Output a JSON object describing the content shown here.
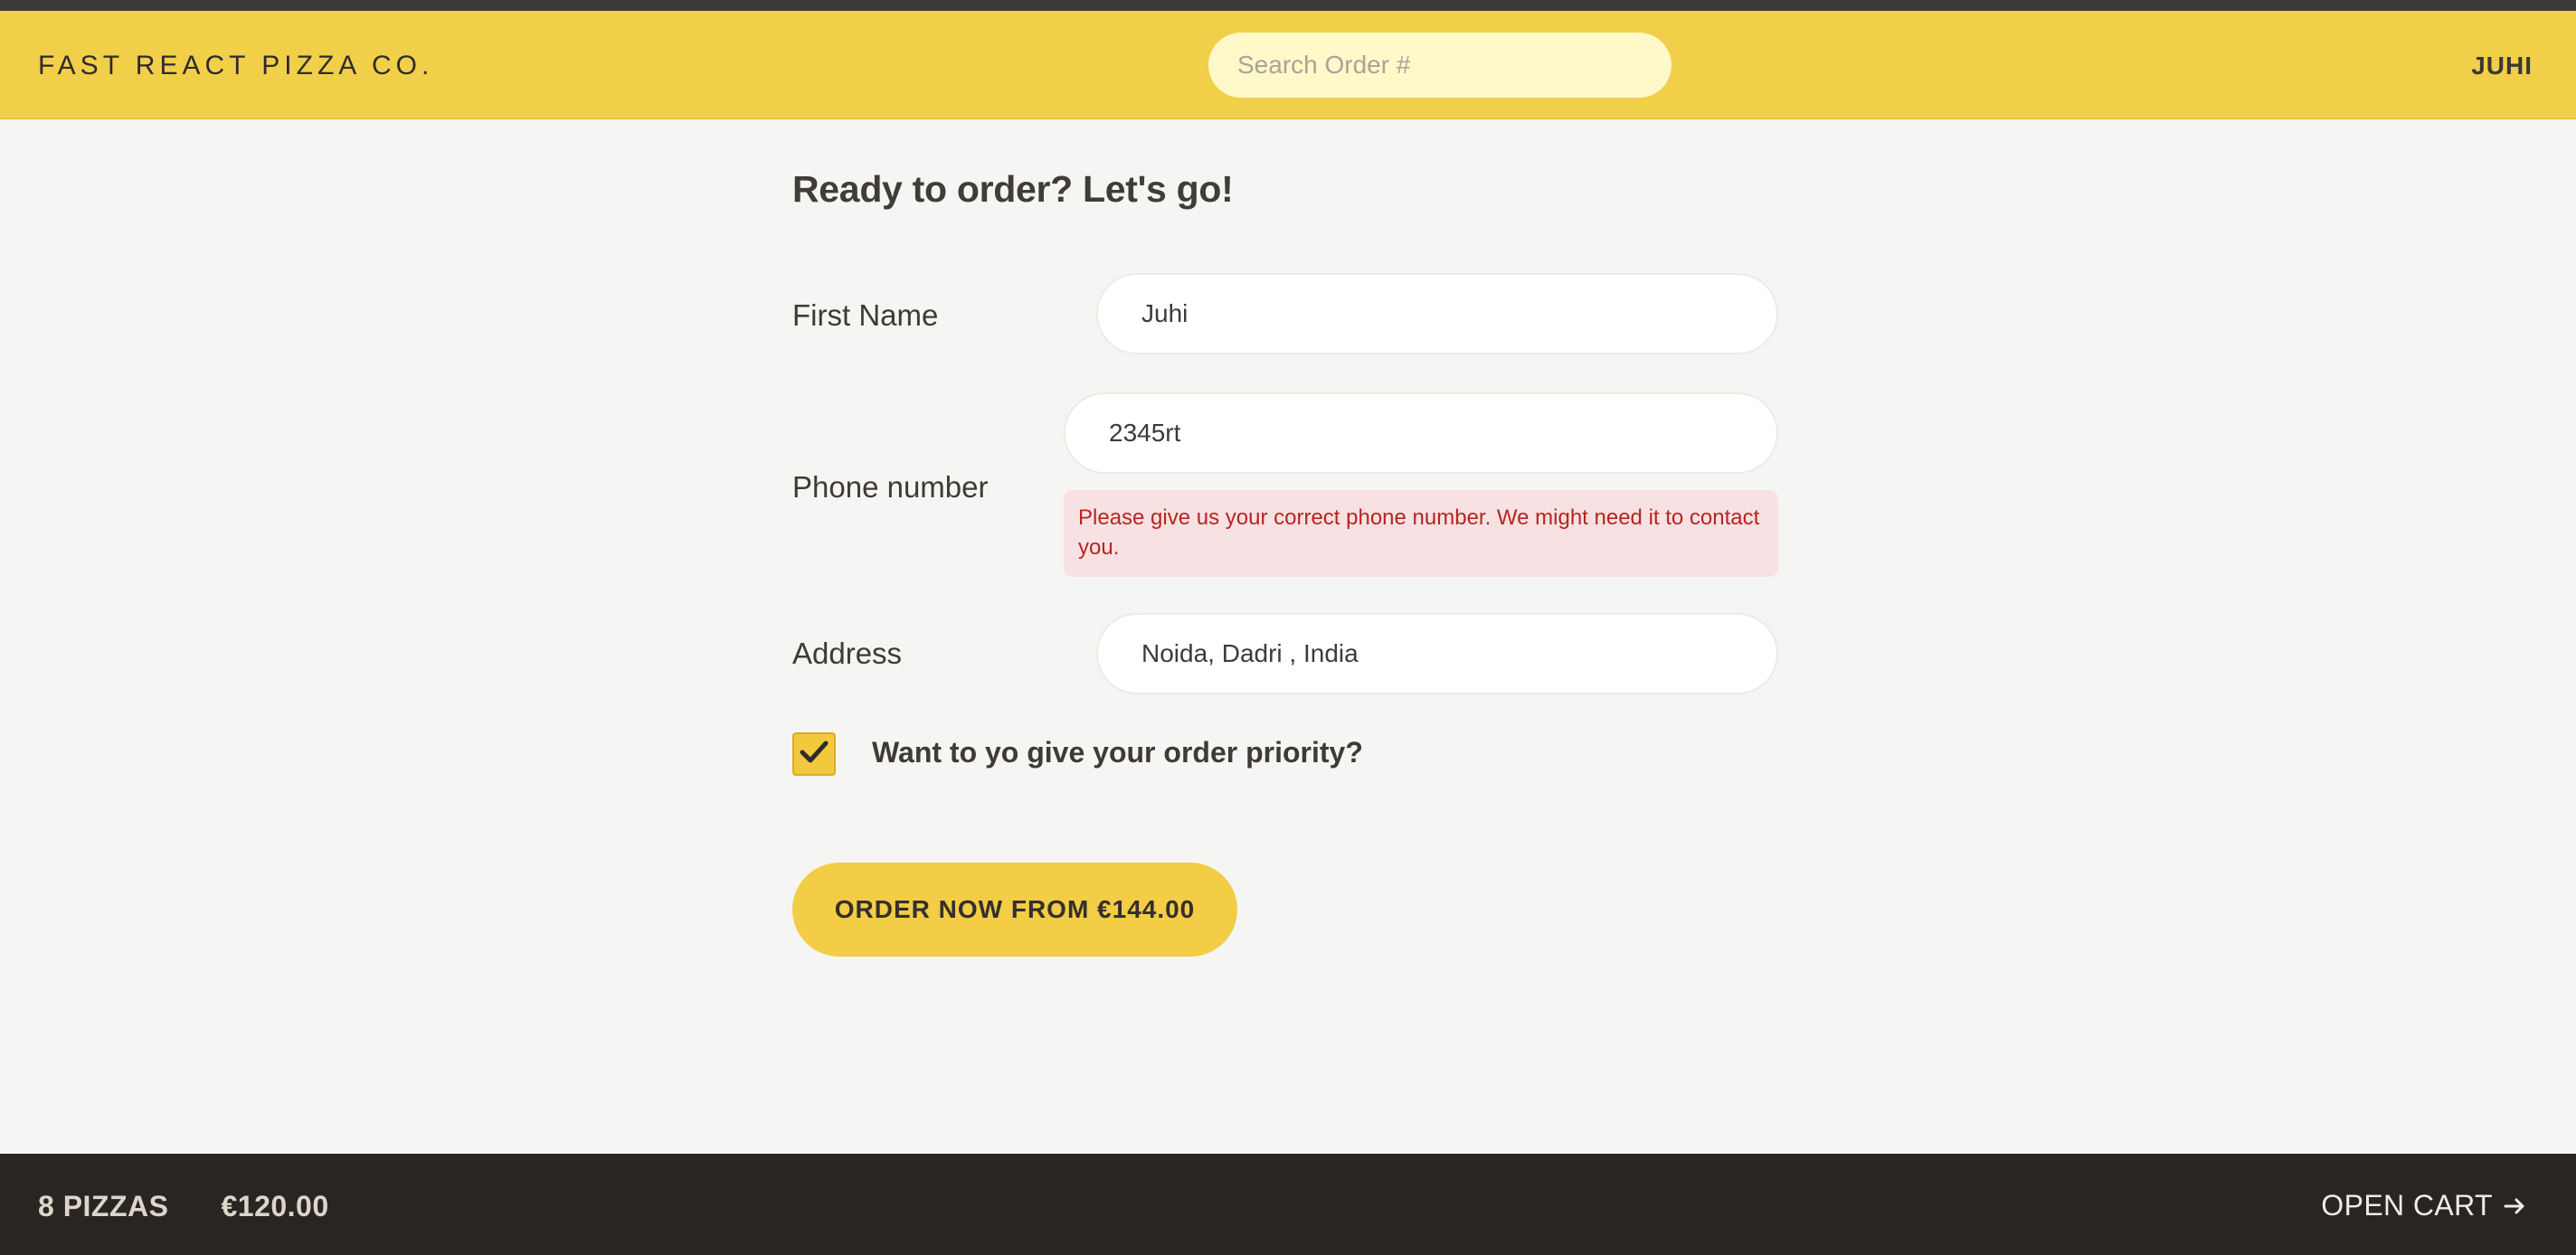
{
  "header": {
    "logo": "FAST REACT PIZZA CO.",
    "search_placeholder": "Search Order #",
    "user": "JUHI"
  },
  "form": {
    "title": "Ready to order? Let's go!",
    "first_name_label": "First Name",
    "first_name_value": "Juhi",
    "phone_label": "Phone number",
    "phone_value": "2345rt",
    "phone_error": "Please give us your correct phone number. We might need it to contact you.",
    "address_label": "Address",
    "address_value": "Noida, Dadri , India",
    "priority_label": "Want to yo give your order priority?",
    "priority_checked": true,
    "submit_label": "ORDER NOW FROM €144.00"
  },
  "footer": {
    "pizza_count": "8 PIZZAS",
    "cart_total": "€120.00",
    "open_cart": "OPEN CART"
  },
  "colors": {
    "brand_yellow": "#f2cf49",
    "footer_dark": "#292523",
    "error_bg": "#f8e1e2",
    "error_text": "#b5261f"
  },
  "icons": {
    "checkbox": "check-icon",
    "cart_arrow": "arrow-right-icon"
  }
}
